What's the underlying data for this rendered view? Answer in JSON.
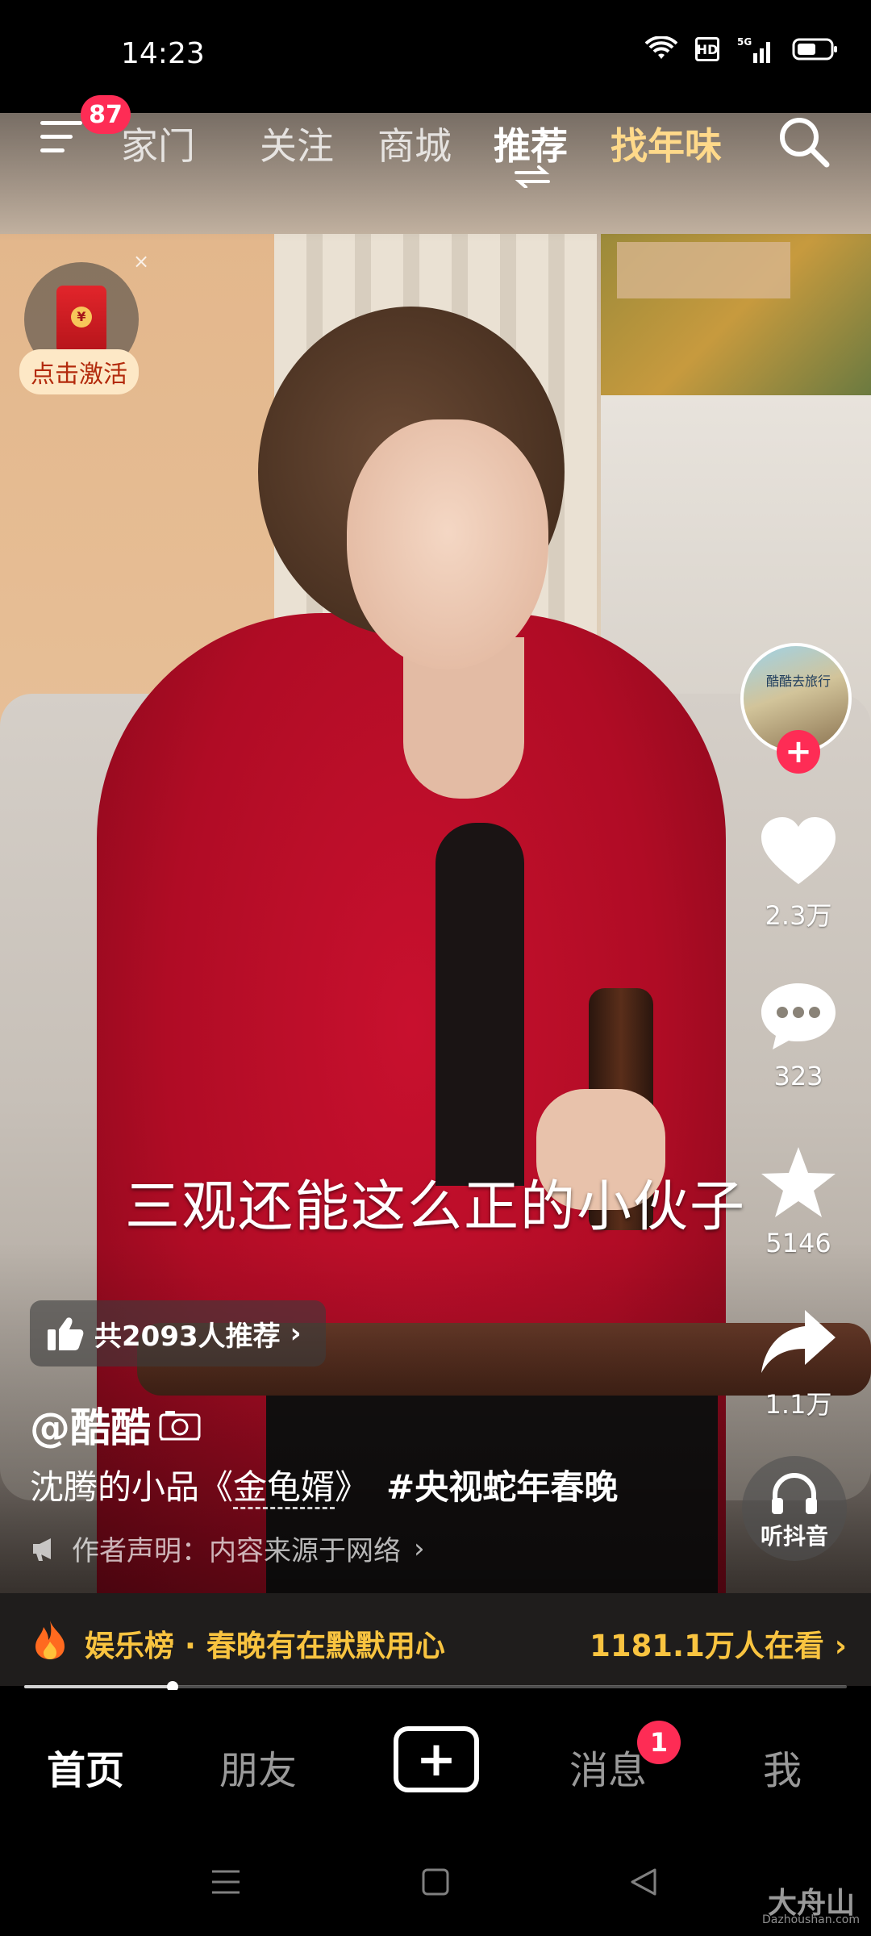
{
  "status_bar": {
    "time": "14:23",
    "network": "5G",
    "hd_label": "HD",
    "icons": [
      "wifi-icon",
      "hd-icon",
      "cellular-signal-icon",
      "battery-icon"
    ]
  },
  "top_nav": {
    "menu_badge": "87",
    "tabs": [
      {
        "label": "家门"
      },
      {
        "label": "关注"
      },
      {
        "label": "商城"
      },
      {
        "label": "推荐"
      },
      {
        "label": "找年味"
      }
    ],
    "active_tab": "推荐",
    "icons": [
      "menu-icon",
      "swap-icon",
      "search-icon"
    ]
  },
  "red_packet": {
    "label": "点击激活",
    "close": "×"
  },
  "creator": {
    "avatar_text": "酷酷去旅行",
    "follow_symbol": "+"
  },
  "actions": {
    "like_count": "2.3万",
    "comment_count": "323",
    "favorite_count": "5146",
    "share_count": "1.1万",
    "listen_label": "听抖音"
  },
  "video": {
    "subtitle": "三观还能这么正的小伙子"
  },
  "recommend": {
    "text": "共2093人推荐",
    "chevron": "›"
  },
  "post": {
    "author": "@酷酷",
    "desc_prefix": "沈腾的小品《",
    "desc_link": "金龟婿",
    "desc_suffix": "》",
    "hashtag": "#央视蛇年春晚",
    "disclaimer": "作者声明：内容来源于网络",
    "disclaimer_chevron": "›"
  },
  "trending": {
    "title": "娱乐榜 · 春晚有在默默用心",
    "count": "1181.1万人在看",
    "chevron": "›"
  },
  "progress": {
    "fraction": 0.18
  },
  "bottom_nav": {
    "items": [
      {
        "label": "首页"
      },
      {
        "label": "朋友"
      },
      {
        "label": "+"
      },
      {
        "label": "消息"
      },
      {
        "label": "我"
      }
    ],
    "active": "首页",
    "message_badge": "1"
  },
  "watermark": {
    "logo": "大舟山",
    "url": "Dazhoushan.com"
  },
  "colors": {
    "accent_pink": "#fe2c55",
    "trend_gold": "#f9c440",
    "special_tab": "#ffd98a"
  }
}
